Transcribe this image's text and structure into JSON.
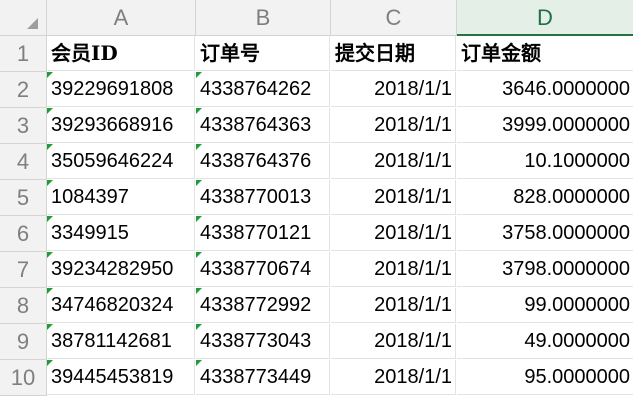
{
  "columns": [
    "A",
    "B",
    "C",
    "D"
  ],
  "selected_column": "D",
  "colors": {
    "header_bg": "#f2f2f2",
    "selected_header_bg": "#e4efe7",
    "selected_header_text": "#1e7145",
    "text_number_flag": "#1f9d3a"
  },
  "rows": [
    {
      "num": "1",
      "a": "会员ID",
      "b": "订单号",
      "c": "提交日期",
      "d": "订单金额"
    },
    {
      "num": "2",
      "a": "39229691808",
      "b": "4338764262",
      "c": "2018/1/1",
      "d": "3646.0000000"
    },
    {
      "num": "3",
      "a": "39293668916",
      "b": "4338764363",
      "c": "2018/1/1",
      "d": "3999.0000000"
    },
    {
      "num": "4",
      "a": "35059646224",
      "b": "4338764376",
      "c": "2018/1/1",
      "d": "10.1000000"
    },
    {
      "num": "5",
      "a": "1084397",
      "b": "4338770013",
      "c": "2018/1/1",
      "d": "828.0000000"
    },
    {
      "num": "6",
      "a": "3349915",
      "b": "4338770121",
      "c": "2018/1/1",
      "d": "3758.0000000"
    },
    {
      "num": "7",
      "a": "39234282950",
      "b": "4338770674",
      "c": "2018/1/1",
      "d": "3798.0000000"
    },
    {
      "num": "8",
      "a": "34746820324",
      "b": "4338772992",
      "c": "2018/1/1",
      "d": "99.0000000"
    },
    {
      "num": "9",
      "a": "38781142681",
      "b": "4338773043",
      "c": "2018/1/1",
      "d": "49.0000000"
    },
    {
      "num": "10",
      "a": "39445453819",
      "b": "4338773449",
      "c": "2018/1/1",
      "d": "95.0000000"
    }
  ]
}
